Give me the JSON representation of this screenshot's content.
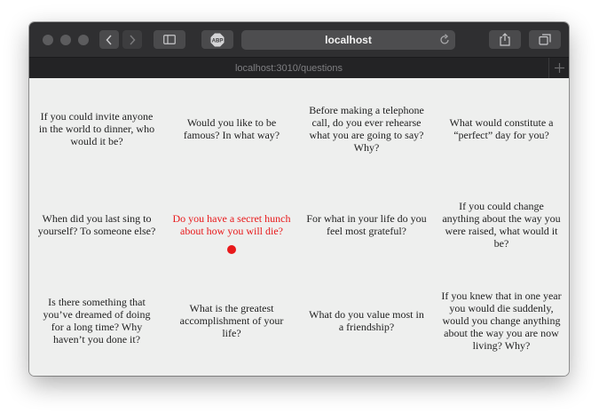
{
  "browser": {
    "address": "localhost",
    "tab_title": "localhost:3010/questions",
    "icons": {
      "back": "chevron-left-icon",
      "forward": "chevron-right-icon",
      "sidebar": "sidebar-icon",
      "adblock": "abp-icon",
      "reload": "reload-icon",
      "share": "share-icon",
      "tabs": "tabs-overview-icon",
      "new_tab": "plus-icon"
    },
    "adblock_label": "ABP"
  },
  "questions": [
    "If you could invite anyone in the world to dinner, who would it be?",
    "Would you like to be famous? In what way?",
    "Before making a telephone call, do you ever rehearse what you are going to say? Why?",
    "What would constitute a “perfect” day for you?",
    "When did you last sing to yourself? To someone else?",
    "Do you have a secret hunch about how you will die?",
    "For what in your life do you feel most grateful?",
    "If you could change anything about the way you were raised, what would it be?",
    "Is there something that you’ve dreamed of doing for a long time? Why haven’t you done it?",
    "What is the greatest accomplishment of your life?",
    "What do you value most in a friendship?",
    "If you knew that in one year you would die suddenly, would you change anything about the way you are now living? Why?"
  ],
  "active_question_index": 5,
  "colors": {
    "active": "#e8191b",
    "text": "#222222",
    "background": "#eeefee"
  }
}
